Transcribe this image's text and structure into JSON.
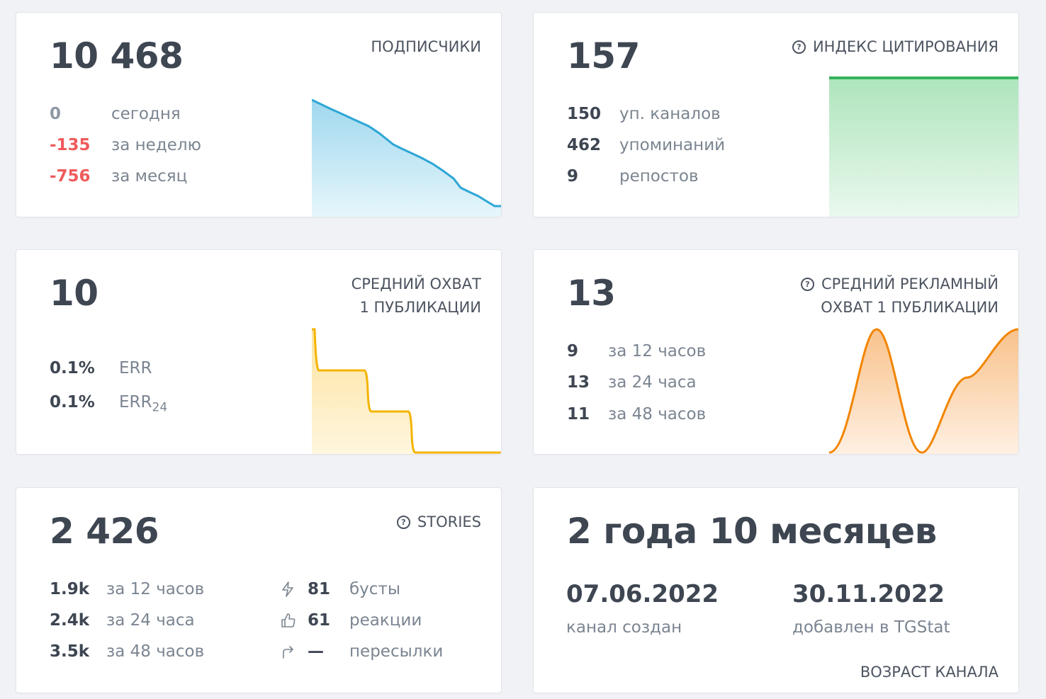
{
  "subscribers": {
    "value": "10 468",
    "title": "ПОДПИСЧИКИ",
    "rows": [
      {
        "value": "0",
        "label": "сегодня"
      },
      {
        "value": "-135",
        "label": "за неделю"
      },
      {
        "value": "-756",
        "label": "за месяц"
      }
    ],
    "colors": {
      "line": "#2ea6d6",
      "fill": "#a9def1"
    }
  },
  "citation": {
    "value": "157",
    "title": "ИНДЕКС ЦИТИРОВАНИЯ",
    "rows": [
      {
        "value": "150",
        "label": "уп. каналов"
      },
      {
        "value": "462",
        "label": "упоминаний"
      },
      {
        "value": "9",
        "label": "репостов"
      }
    ],
    "colors": {
      "line": "#35b45a",
      "fill": "#b6e8c2"
    }
  },
  "reach": {
    "value": "10",
    "title_line1": "СРЕДНИЙ ОХВАТ",
    "title_line2": "1 ПУБЛИКАЦИИ",
    "err": {
      "value": "0.1%",
      "label": "ERR"
    },
    "err24": {
      "value": "0.1%",
      "label": "ERR",
      "sub": "24"
    },
    "colors": {
      "line": "#f4b400",
      "fill": "#fde9b2"
    }
  },
  "ad_reach": {
    "value": "13",
    "title_line1": "СРЕДНИЙ РЕКЛАМНЫЙ",
    "title_line2": "ОХВАТ 1 ПУБЛИКАЦИИ",
    "rows": [
      {
        "value": "9",
        "label": "за 12 часов"
      },
      {
        "value": "13",
        "label": "за 24 часа"
      },
      {
        "value": "11",
        "label": "за 48 часов"
      }
    ],
    "colors": {
      "line": "#f28500",
      "fill": "#fbd3a9"
    }
  },
  "stories": {
    "value": "2 426",
    "title": "STORIES",
    "rows": [
      {
        "value": "1.9k",
        "label": "за 12 часов"
      },
      {
        "value": "2.4k",
        "label": "за 24 часа"
      },
      {
        "value": "3.5k",
        "label": "за 48 часов"
      }
    ],
    "extras": [
      {
        "icon": "lightning-icon",
        "value": "81",
        "label": "бусты"
      },
      {
        "icon": "thumbs-up-icon",
        "value": "61",
        "label": "реакции"
      },
      {
        "icon": "forward-icon",
        "value": "—",
        "label": "пересылки"
      }
    ]
  },
  "age": {
    "value": "2 года 10 месяцев",
    "created": {
      "date": "07.06.2022",
      "label": "канал создан"
    },
    "added": {
      "date": "30.11.2022",
      "label": "добавлен в TGStat"
    },
    "title": "ВОЗРАСТ КАНАЛА"
  }
}
